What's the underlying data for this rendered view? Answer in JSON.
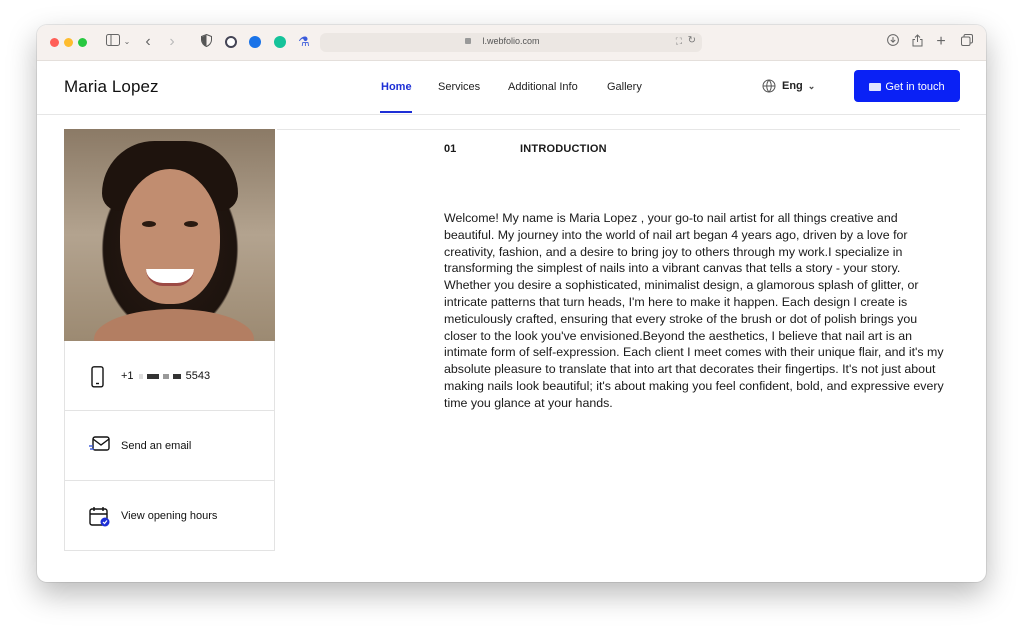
{
  "browser": {
    "url": "l.webfolio.com"
  },
  "site": {
    "brand": "Maria Lopez",
    "nav": [
      "Home",
      "Services",
      "Additional Info",
      "Gallery"
    ],
    "language": "Eng",
    "cta_label": "Get in touch"
  },
  "contact": {
    "phone_prefix": "+1",
    "phone_suffix": "5543",
    "email_label": "Send an email",
    "hours_label": "View opening hours"
  },
  "section": {
    "number": "01",
    "title": "INTRODUCTION",
    "body": "Welcome! My name is Maria Lopez , your go-to nail artist for all things creative and beautiful. My journey into the world of nail art began 4 years ago, driven by a love for creativity, fashion, and a desire to bring joy to others through my work.I specialize in transforming the simplest of nails into a vibrant canvas that tells a story - your story. Whether you desire a sophisticated, minimalist design, a glamorous splash of glitter, or intricate patterns that turn heads, I'm here to make it happen. Each design I create is meticulously crafted, ensuring that every stroke of the brush or dot of polish brings you closer to the look you've envisioned.Beyond the aesthetics, I believe that nail art is an intimate form of self-expression. Each client I meet comes with their unique flair, and it's my absolute pleasure to translate that into art that decorates their fingertips. It's not just about making nails look beautiful; it's about making you feel confident, bold, and expressive every time you glance at your hands."
  },
  "colors": {
    "accent": "#1d2fd6",
    "button": "#0a21f5"
  }
}
